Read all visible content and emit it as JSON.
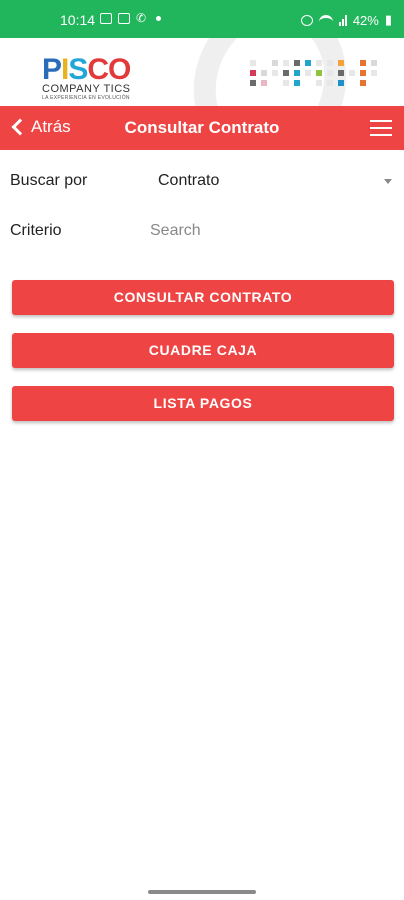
{
  "status_bar": {
    "time": "10:14",
    "battery": "42%"
  },
  "header": {
    "logo": {
      "letters": [
        {
          "char": "P",
          "color": "#2b6cb8"
        },
        {
          "char": "I",
          "color": "#e7b31f"
        },
        {
          "char": "S",
          "color": "#22a6d8"
        },
        {
          "char": "C",
          "color": "#e23a3a"
        },
        {
          "char": "O",
          "color": "#e23a3a"
        }
      ],
      "sub": "COMPANY TICS",
      "tag": "LA EXPERIENCIA EN EVOLUCIÓN"
    }
  },
  "navbar": {
    "back_label": "Atrás",
    "title": "Consultar Contrato"
  },
  "form": {
    "buscar_label": "Buscar por",
    "buscar_value": "Contrato",
    "criterio_label": "Criterio",
    "criterio_placeholder": "Search",
    "criterio_value": ""
  },
  "buttons": {
    "consultar": "CONSULTAR CONTRATO",
    "cuadre": "CUADRE CAJA",
    "lista": "LISTA PAGOS"
  },
  "colors": {
    "status_bar": "#21b55c",
    "accent": "#ef4444"
  }
}
